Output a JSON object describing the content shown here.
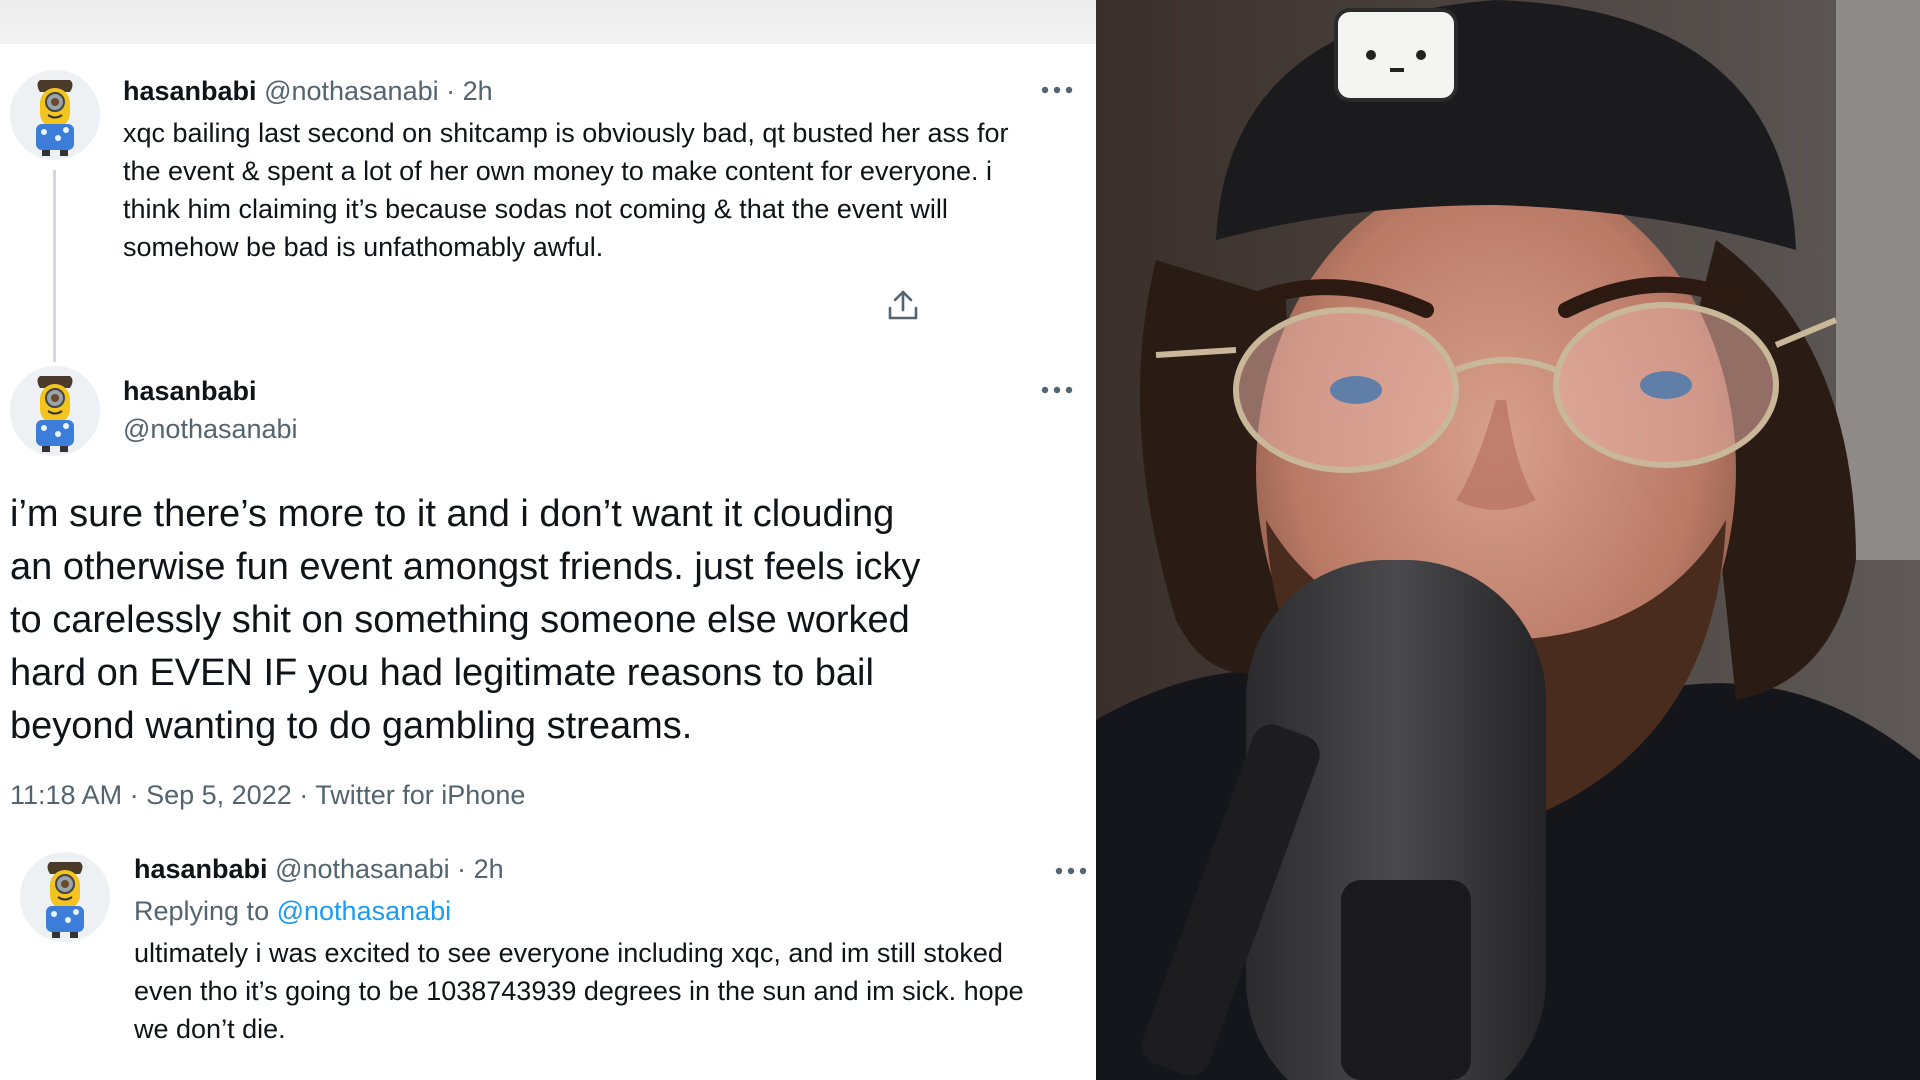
{
  "tweets": [
    {
      "name": "hasanbabi",
      "handle": "@nothasanabi",
      "sep": "·",
      "time": "2h",
      "lines": [
        "xqc bailing last second on shitcamp is obviously bad, qt busted her ass for",
        "the event & spent a lot of her own money to make content for everyone. i",
        "think him claiming it’s because sodas not coming & that the event will",
        "somehow be bad is unfathomably awful."
      ]
    },
    {
      "name": "hasanbabi",
      "handle": "@nothasanabi",
      "lines": [
        "i’m sure there’s more to it and i don’t want it clouding",
        "an otherwise fun event amongst friends. just feels icky",
        "to carelessly shit on something someone else worked",
        "hard on EVEN IF you had legitimate reasons to bail",
        "beyond wanting to do gambling streams."
      ],
      "time": "11:18 AM",
      "date": "Sep 5, 2022",
      "source": "Twitter for iPhone",
      "sep": "·"
    },
    {
      "name": "hasanbabi",
      "handle": "@nothasanabi",
      "sep": "·",
      "time": "2h",
      "replying_label": "Replying to",
      "replying_handle": "@nothasanabi",
      "lines": [
        "ultimately i was excited to see everyone including xqc, and im still stoked",
        "even tho it’s going to be 1038743939 degrees in the sun and im sick. hope",
        "we don’t die."
      ]
    }
  ],
  "icons": {
    "more": "more-icon",
    "share": "share-icon",
    "avatar": "minion-avatar"
  },
  "colors": {
    "text": "#0f1419",
    "secondary": "#536471",
    "link": "#1d9bf0",
    "thread_line": "#cfd9de"
  }
}
